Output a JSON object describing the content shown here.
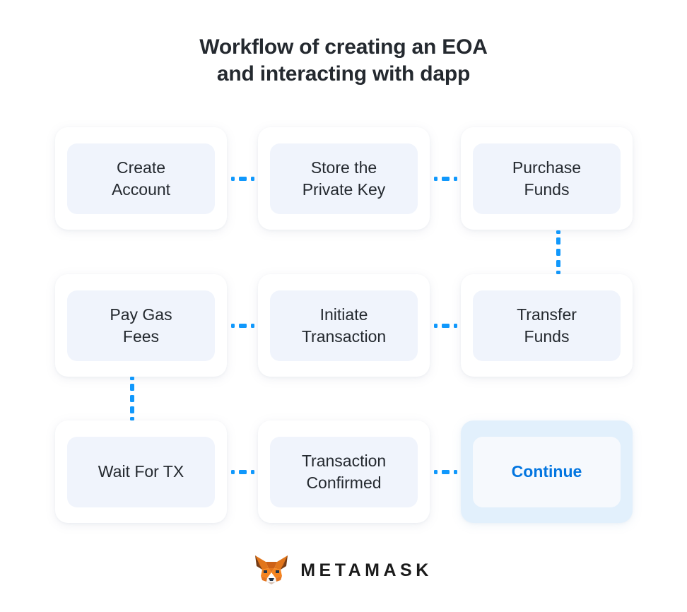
{
  "title": {
    "line1": "Workflow of creating an EOA",
    "line2": "and interacting with dapp"
  },
  "colors": {
    "accent_blue": "#1098fc",
    "continue_text": "#0376e0",
    "card_outer": "#ffffff",
    "card_inner": "#f0f4fc",
    "highlight_outer": "#e2f0fc",
    "highlight_inner": "#f6f9fd",
    "text_dark": "#24292f",
    "page_background": "#ffffff"
  },
  "flow": {
    "rows": [
      {
        "row_index": 0,
        "cards": [
          {
            "label": "Create\nAccount",
            "highlight": false
          },
          {
            "label": "Store the\nPrivate Key",
            "highlight": false
          },
          {
            "label": "Purchase\nFunds",
            "highlight": false
          }
        ]
      },
      {
        "row_index": 1,
        "cards": [
          {
            "label": "Pay Gas\nFees",
            "highlight": false
          },
          {
            "label": "Initiate\nTransaction",
            "highlight": false
          },
          {
            "label": "Transfer\nFunds",
            "highlight": false
          }
        ]
      },
      {
        "row_index": 2,
        "cards": [
          {
            "label": "Wait For TX",
            "highlight": false
          },
          {
            "label": "Transaction\nConfirmed",
            "highlight": false
          },
          {
            "label": "Continue",
            "highlight": true
          }
        ]
      }
    ],
    "connectors": {
      "horizontal_count_per_row": 2,
      "vertical": [
        {
          "from": "Purchase Funds",
          "to": "Transfer Funds",
          "column": "right"
        },
        {
          "from": "Pay Gas Fees",
          "to": "Wait For TX",
          "column": "left"
        }
      ]
    }
  },
  "brand": {
    "wordmark": "METAMASK",
    "fox_icon": "metamask-fox-icon"
  }
}
